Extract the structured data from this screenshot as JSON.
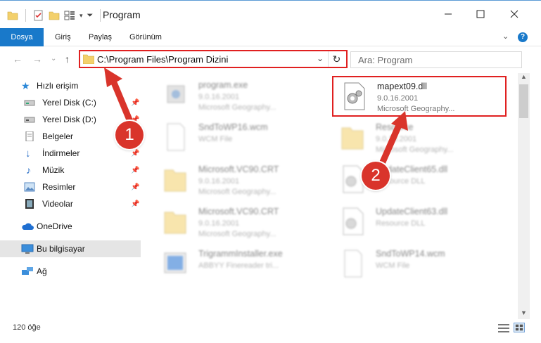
{
  "window": {
    "title": "Program",
    "minimize_icon": "minimize-icon",
    "maximize_icon": "maximize-icon",
    "close_icon": "close-icon"
  },
  "ribbon": {
    "tabs": [
      "Dosya",
      "Giriş",
      "Paylaş",
      "Görünüm"
    ]
  },
  "address": {
    "path": "C:\\Program Files\\Program Dizini",
    "search_placeholder": "Ara: Program"
  },
  "sidebar": {
    "items": [
      {
        "label": "Hızlı erişim",
        "icon": "star-icon",
        "pinned": false
      },
      {
        "label": "Yerel Disk (C:)",
        "icon": "drive-icon",
        "pinned": true
      },
      {
        "label": "Yerel Disk (D:)",
        "icon": "drive-icon",
        "pinned": true
      },
      {
        "label": "Belgeler",
        "icon": "document-icon",
        "pinned": true
      },
      {
        "label": "İndirmeler",
        "icon": "download-icon",
        "pinned": true
      },
      {
        "label": "Müzik",
        "icon": "music-icon",
        "pinned": true
      },
      {
        "label": "Resimler",
        "icon": "pictures-icon",
        "pinned": true
      },
      {
        "label": "Videolar",
        "icon": "video-icon",
        "pinned": true
      },
      {
        "label": "OneDrive",
        "icon": "cloud-icon",
        "pinned": false
      },
      {
        "label": "Bu bilgisayar",
        "icon": "computer-icon",
        "pinned": false
      },
      {
        "label": "Ağ",
        "icon": "network-icon",
        "pinned": false
      }
    ]
  },
  "files": [
    {
      "name": "program.exe",
      "line1": "9.0.16.2001",
      "line2": "Microsoft Geography...",
      "icon": "exe-icon"
    },
    {
      "name": "mapext09.dll",
      "line1": "9.0.16.2001",
      "line2": "Microsoft Geography...",
      "icon": "dll-gear-icon"
    },
    {
      "name": "SndToWP16.wcm",
      "line1": "WCM File",
      "line2": "",
      "icon": "file-icon"
    },
    {
      "name": "Resource",
      "line1": "9.0.16.2001",
      "line2": "Microsoft Geography...",
      "icon": "folder-icon"
    },
    {
      "name": "Microsoft.VC90.CRT",
      "line1": "9.0.16.2001",
      "line2": "Microsoft Geography...",
      "icon": "folder-icon"
    },
    {
      "name": "UpdateClient65.dll",
      "line1": "Resource DLL",
      "line2": "",
      "icon": "dll-gear-icon"
    },
    {
      "name": "Microsoft.VC90.CRT",
      "line1": "9.0.16.2001",
      "line2": "Microsoft Geography...",
      "icon": "folder-icon"
    },
    {
      "name": "UpdateClient63.dll",
      "line1": "Resource DLL",
      "line2": "",
      "icon": "dll-gear-icon"
    },
    {
      "name": "TrigrammInstaller.exe",
      "line1": "ABBYY Finereader tri...",
      "line2": "",
      "icon": "installer-icon"
    },
    {
      "name": "SndToWP14.wcm",
      "line1": "WCM File",
      "line2": "",
      "icon": "file-icon"
    }
  ],
  "status": {
    "count": "120 öğe"
  },
  "callouts": [
    "1",
    "2"
  ],
  "colors": {
    "accent": "#1979ca",
    "highlight": "#e02020",
    "callout": "#d9342b"
  }
}
